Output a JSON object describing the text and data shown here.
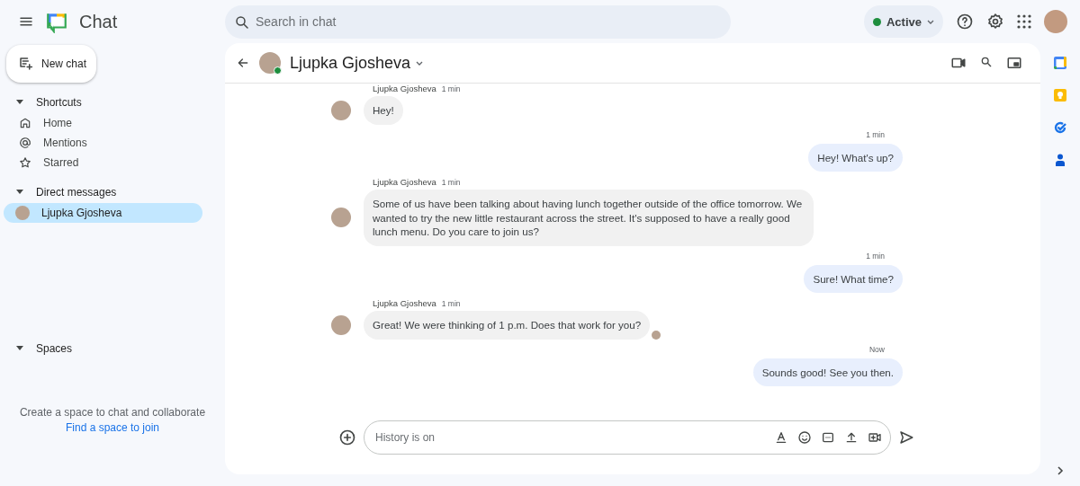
{
  "app": {
    "title": "Chat"
  },
  "search": {
    "placeholder": "Search in chat"
  },
  "status": {
    "label": "Active"
  },
  "new_chat": {
    "label": "New chat"
  },
  "sections": [
    {
      "label": "Shortcuts",
      "expanded": true,
      "items": [
        {
          "label": "Home",
          "kind": "home",
          "selected": false
        },
        {
          "label": "Mentions",
          "kind": "mention",
          "selected": false
        },
        {
          "label": "Starred",
          "kind": "star",
          "selected": false
        }
      ]
    },
    {
      "label": "Direct messages",
      "expanded": true,
      "items": [
        {
          "label": "Ljupka Gjosheva",
          "kind": "person",
          "selected": true
        }
      ]
    },
    {
      "label": "Spaces",
      "expanded": true
    }
  ],
  "spaces_empty": {
    "text": "Create a space to chat and collaborate",
    "link": "Find a space to join"
  },
  "conversation": {
    "title": "Ljupka Gjosheva",
    "online": true
  },
  "messages": [
    {
      "kind": "incoming",
      "sender": "Ljupka Gjosheva",
      "time": "1 min",
      "text": "Hey!",
      "seen": false
    },
    {
      "kind": "outgoing",
      "time": "1 min",
      "text": "Hey! What's up?"
    },
    {
      "kind": "incoming",
      "sender": "Ljupka Gjosheva",
      "time": "1 min",
      "text": "Some of us have been talking about having lunch together outside of the office tomorrow. We wanted to try the new little restaurant across the street. It's supposed to have a really good lunch menu. Do you care to join us?",
      "seen": false
    },
    {
      "kind": "outgoing",
      "time": "1 min",
      "text": "Sure! What time?"
    },
    {
      "kind": "incoming",
      "sender": "Ljupka Gjosheva",
      "time": "1 min",
      "text": "Great! We were thinking of 1 p.m. Does that work for you?",
      "seen": true
    },
    {
      "kind": "outgoing",
      "time": "Now",
      "text": "Sounds good! See you then."
    }
  ],
  "composer": {
    "placeholder": "History is on"
  }
}
